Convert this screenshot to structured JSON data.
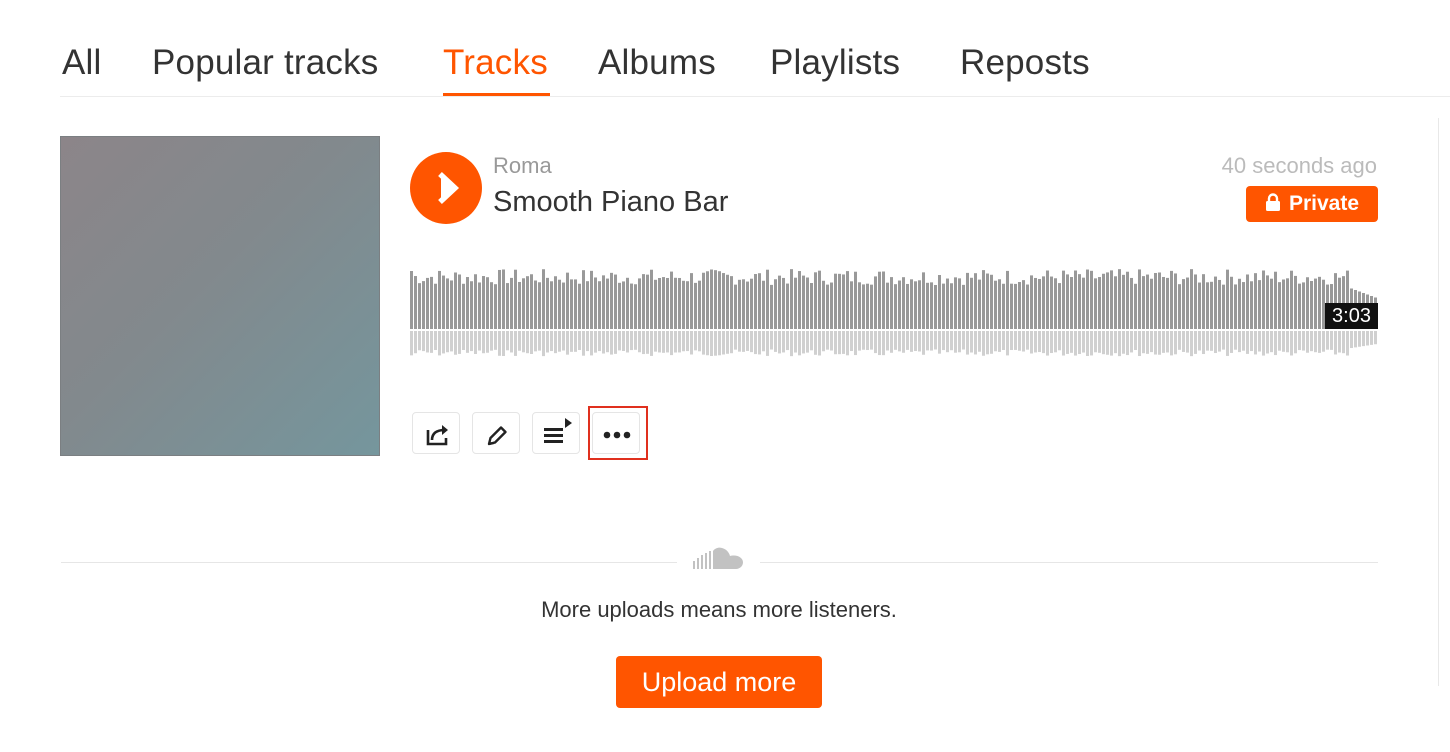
{
  "tabs": [
    {
      "label": "All",
      "active": false
    },
    {
      "label": "Popular tracks",
      "active": false
    },
    {
      "label": "Tracks",
      "active": true
    },
    {
      "label": "Albums",
      "active": false
    },
    {
      "label": "Playlists",
      "active": false
    },
    {
      "label": "Reposts",
      "active": false
    }
  ],
  "track": {
    "artist": "Roma",
    "title": "Smooth Piano Bar",
    "posted": "40 seconds ago",
    "privacy_label": "Private",
    "duration": "3:03",
    "artwork_colors": [
      "#8c8589",
      "#75969d"
    ]
  },
  "actions": [
    {
      "name": "share-button",
      "icon": "share-icon"
    },
    {
      "name": "edit-button",
      "icon": "pencil-icon"
    },
    {
      "name": "add-to-next-up-button",
      "icon": "queue-icon"
    },
    {
      "name": "more-button",
      "icon": "more-icon"
    }
  ],
  "footer": {
    "message": "More uploads means more listeners.",
    "upload_label": "Upload more"
  },
  "colors": {
    "accent": "#ff5500",
    "waveform_top": "#999999",
    "waveform_bottom": "#d0d0d0",
    "highlight": "#e0301e"
  }
}
